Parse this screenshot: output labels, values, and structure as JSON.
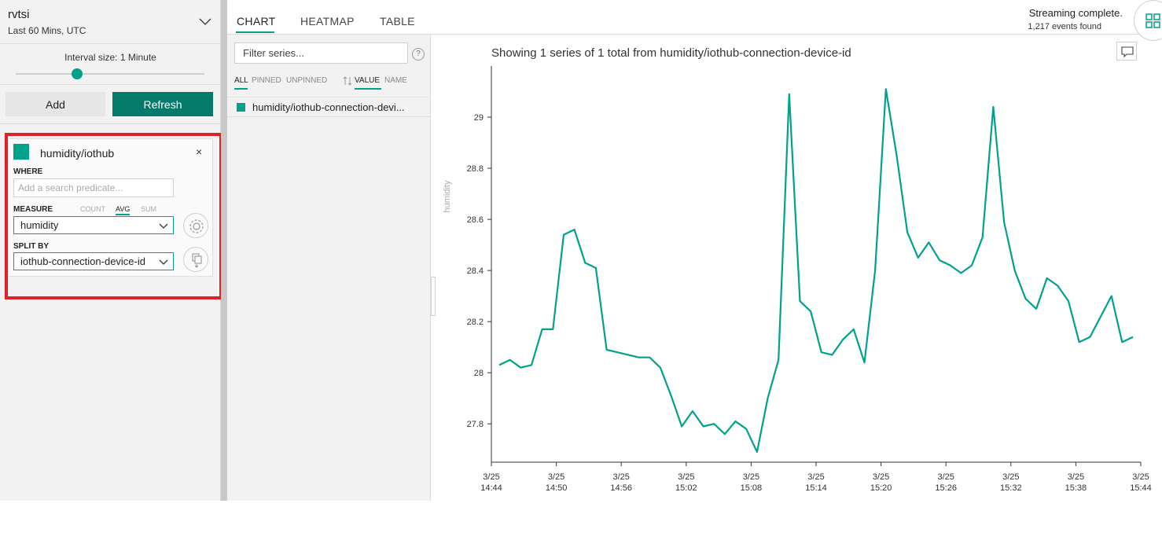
{
  "environment": {
    "name": "rvtsi",
    "range": "Last 60 Mins, UTC"
  },
  "interval": {
    "label": "Interval size: 1 Minute",
    "position": 0.33
  },
  "buttons": {
    "add": "Add",
    "refresh": "Refresh"
  },
  "term": {
    "title": "humidity/iothub",
    "close": "×",
    "where_label": "WHERE",
    "where_placeholder": "Add a search predicate...",
    "measure_label": "MEASURE",
    "aggregates": [
      "COUNT",
      "AVG",
      "SUM"
    ],
    "active_aggregate": "AVG",
    "measure_value": "humidity",
    "split_label": "SPLIT BY",
    "split_value": "iothub-connection-device-id",
    "swatch_color": "#01a18b"
  },
  "tabs": [
    "CHART",
    "HEATMAP",
    "TABLE"
  ],
  "status": {
    "line1": "Streaming complete.",
    "line2": "1,217 events found"
  },
  "series_panel": {
    "filter_placeholder": "Filter series...",
    "help": "?",
    "filters": [
      "ALL",
      "PINNED",
      "UNPINNED"
    ],
    "sorts": [
      "VALUE",
      "NAME"
    ],
    "items": [
      {
        "label": "humidity/iothub-connection-devi..."
      }
    ]
  },
  "chart_title": "Showing 1 series of 1 total from humidity/iothub-connection-device-id",
  "chart_data": {
    "type": "line",
    "title": "Showing 1 series of 1 total from humidity/iothub-connection-device-id",
    "xlabel": "",
    "ylabel": "humidity",
    "ylim": [
      27.65,
      29.2
    ],
    "xlim": [
      "3/25 14:44",
      "3/25 15:44"
    ],
    "x_ticks": [
      [
        "3/25",
        "14:44"
      ],
      [
        "3/25",
        "14:50"
      ],
      [
        "3/25",
        "14:56"
      ],
      [
        "3/25",
        "15:02"
      ],
      [
        "3/25",
        "15:08"
      ],
      [
        "3/25",
        "15:14"
      ],
      [
        "3/25",
        "15:20"
      ],
      [
        "3/25",
        "15:26"
      ],
      [
        "3/25",
        "15:32"
      ],
      [
        "3/25",
        "15:38"
      ],
      [
        "3/25",
        "15:44"
      ]
    ],
    "y_ticks": [
      27.8,
      28,
      28.2,
      28.4,
      28.6,
      28.8,
      29
    ],
    "series": [
      {
        "color": "#01a18b",
        "values": [
          28.03,
          28.05,
          28.02,
          28.03,
          28.17,
          28.17,
          28.54,
          28.56,
          28.43,
          28.41,
          28.09,
          28.08,
          28.07,
          28.06,
          28.06,
          28.02,
          27.91,
          27.79,
          27.85,
          27.79,
          27.8,
          27.76,
          27.81,
          27.78,
          27.69,
          27.9,
          28.05,
          29.09,
          28.28,
          28.24,
          28.08,
          28.07,
          28.13,
          28.17,
          28.04,
          28.4,
          29.11,
          28.85,
          28.55,
          28.45,
          28.51,
          28.44,
          28.42,
          28.39,
          28.42,
          28.53,
          29.04,
          28.59,
          28.4,
          28.29,
          28.25,
          28.37,
          28.34,
          28.28,
          28.12,
          28.14,
          28.22,
          28.3,
          28.12,
          28.14
        ]
      }
    ]
  }
}
